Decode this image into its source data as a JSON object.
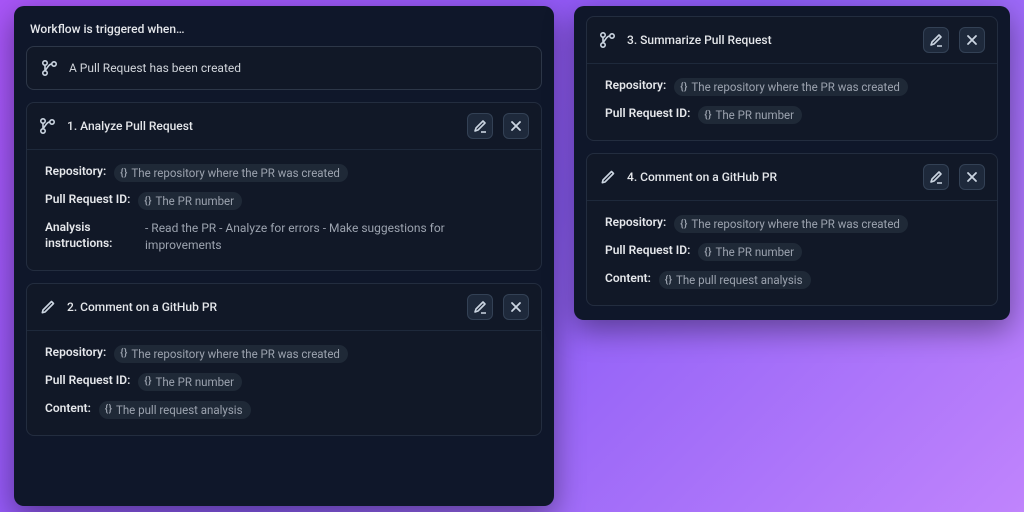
{
  "trigger": {
    "title": "Workflow is triggered when…",
    "event": "A Pull Request has been created"
  },
  "steps": [
    {
      "icon": "branch",
      "title": "1.  Analyze Pull Request",
      "params": [
        {
          "label": "Repository:",
          "token": "The repository where the PR was created"
        },
        {
          "label": "Pull Request ID:",
          "token": "The PR number"
        },
        {
          "label": "Analysis instructions:",
          "plain": "- Read the PR - Analyze for errors - Make suggestions for improvements",
          "wide": true
        }
      ]
    },
    {
      "icon": "pencil",
      "title": "2.  Comment on a GitHub PR",
      "params": [
        {
          "label": "Repository:",
          "token": "The repository where the PR was created"
        },
        {
          "label": "Pull Request ID:",
          "token": "The PR number"
        },
        {
          "label": "Content:",
          "token": "The pull request analysis"
        }
      ]
    },
    {
      "icon": "branch",
      "title": "3.  Summarize Pull Request",
      "params": [
        {
          "label": "Repository:",
          "token": "The repository where the PR was created"
        },
        {
          "label": "Pull Request ID:",
          "token": "The PR number"
        }
      ]
    },
    {
      "icon": "pencil",
      "title": "4.  Comment on a GitHub PR",
      "params": [
        {
          "label": "Repository:",
          "token": "The repository where the PR was created"
        },
        {
          "label": "Pull Request ID:",
          "token": "The PR number"
        },
        {
          "label": "Content:",
          "token": "The pull request analysis"
        }
      ]
    }
  ]
}
